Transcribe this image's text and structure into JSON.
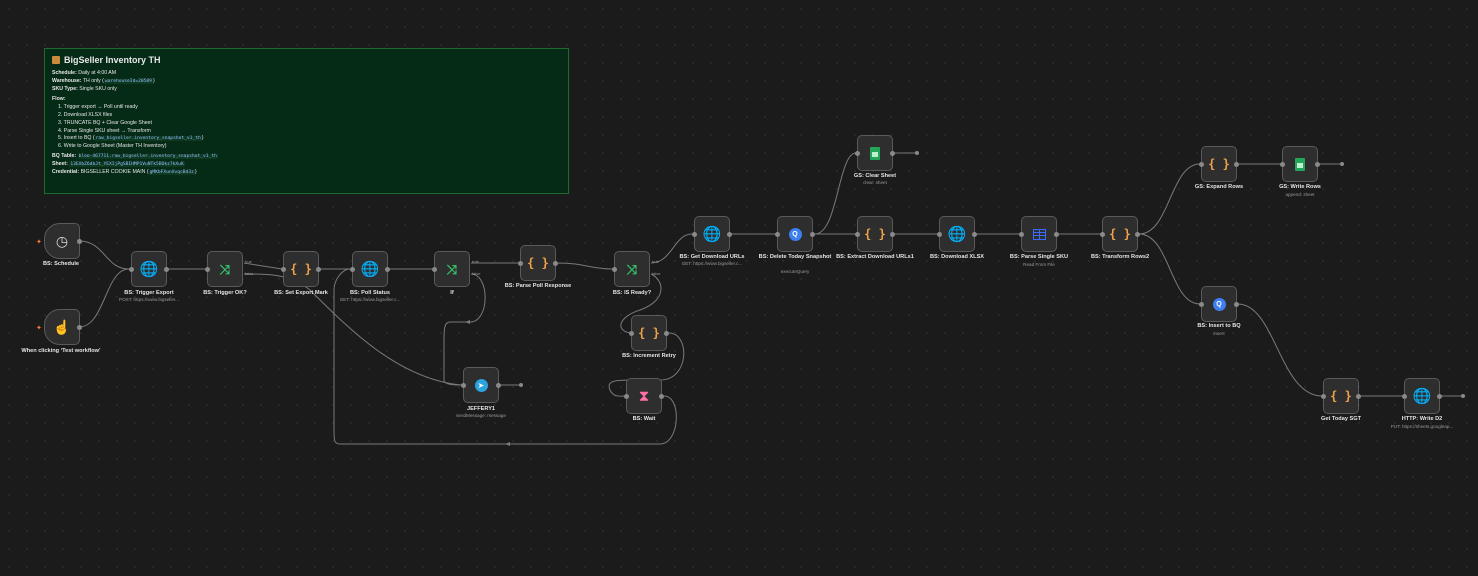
{
  "sticky": {
    "title": "BigSeller Inventory TH",
    "schedule_label": "Schedule:",
    "schedule_value": "Daily at 4:00 AM",
    "warehouse_label": "Warehouse:",
    "warehouse_value": "TH only",
    "warehouse_code": "warehouseId=20589",
    "sku_label": "SKU Type:",
    "sku_value": "Single SKU only",
    "flow_label": "Flow:",
    "flow_steps": [
      "1. Trigger export → Poll until ready",
      "2. Download XLSX files",
      "3. TRUNCATE BQ + Clear Google Sheet",
      "4. Parse Single SKU sheet → Transform",
      "5. Insert to BQ (",
      "6. Write to Google Sheet (Master TH Inventory)"
    ],
    "step5_code": "raw_bigseller.inventory_snapshot_v1_th",
    "step5_end": ")",
    "bq_table_label": "BQ Table:",
    "bq_table_value": "bloo-467711.raw_bigseller.inventory_snapshot_v1_th",
    "sheet_label": "Sheet:",
    "sheet_value": "13EXbZ6dbJt_YEXIjPgSBIHMP1VuNTk5BOkz7kXuK",
    "cred_label": "Credential:",
    "cred_value": "BIGSELLER COOKIE MAIN (",
    "cred_code": "gMKbFXunXvqcBd3z",
    "cred_end": ")"
  },
  "nodes": {
    "schedule": {
      "label": "BS: Schedule",
      "icon": "clock-icon"
    },
    "manual": {
      "label": "When clicking ‘Test workflow’",
      "icon": "cursor-icon"
    },
    "trigger_export": {
      "label": "BS: Trigger Export",
      "sub": "POST: https://www.bigseller...",
      "icon": "globe-icon"
    },
    "trigger_ok": {
      "label": "BS: Trigger OK?",
      "icon": "if-branch-icon",
      "true": "true",
      "false": "false"
    },
    "set_export_mark": {
      "label": "BS: Set Export Mark",
      "icon": "code-braces-icon"
    },
    "poll_status": {
      "label": "BS: Poll Status",
      "sub": "GET: https://www.bigseller.c...",
      "icon": "globe-icon"
    },
    "if": {
      "label": "If",
      "icon": "if-branch-icon",
      "true": "true",
      "false": "false"
    },
    "parse_poll": {
      "label": "BS: Parse Poll Response",
      "icon": "code-braces-icon"
    },
    "is_ready": {
      "label": "BS: IS Ready?",
      "icon": "if-branch-icon",
      "true": "true",
      "false": "false"
    },
    "increment_retry": {
      "label": "BS: Increment Retry",
      "icon": "code-braces-icon"
    },
    "wait": {
      "label": "BS: Wait",
      "icon": "hourglass-icon"
    },
    "jeffery": {
      "label": "JEFFERY1",
      "sub": "sendMessage: message",
      "icon": "telegram-icon"
    },
    "get_download_urls": {
      "label": "BS: Get Download URLs",
      "sub": "GET: https://www.bigseller.c...",
      "icon": "globe-icon"
    },
    "delete_snapshot": {
      "label": "BS: Delete Today Snapshot",
      "sub": "executeQuery",
      "icon": "bigquery-icon",
      "toolbar": "1"
    },
    "clear_sheet": {
      "label": "GS: Clear Sheet",
      "sub": "clear: sheet",
      "icon": "sheets-icon"
    },
    "extract_urls": {
      "label": "BS: Extract Download URLs1",
      "icon": "code-braces-icon"
    },
    "download_xlsx": {
      "label": "BS: Download XLSX",
      "icon": "globe-icon"
    },
    "parse_single_sku": {
      "label": "BS: Parse Single SKU",
      "sub": "Read From File",
      "icon": "table-icon"
    },
    "transform_rows": {
      "label": "BS: Transform Rows2",
      "icon": "code-braces-icon"
    },
    "expand_rows": {
      "label": "GS: Expand Rows",
      "icon": "code-braces-icon"
    },
    "write_rows": {
      "label": "GS: Write Rows",
      "sub": "append: sheet",
      "icon": "sheets-icon"
    },
    "insert_bq": {
      "label": "BS: Insert to BQ",
      "sub": "insert",
      "icon": "bigquery-icon"
    },
    "get_today_sgt": {
      "label": "Get Today SGT",
      "icon": "code-braces-icon"
    },
    "http_write": {
      "label": "HTTP: Write D2",
      "sub": "PUT: https://sheets.googleap...",
      "icon": "globe-icon"
    }
  }
}
